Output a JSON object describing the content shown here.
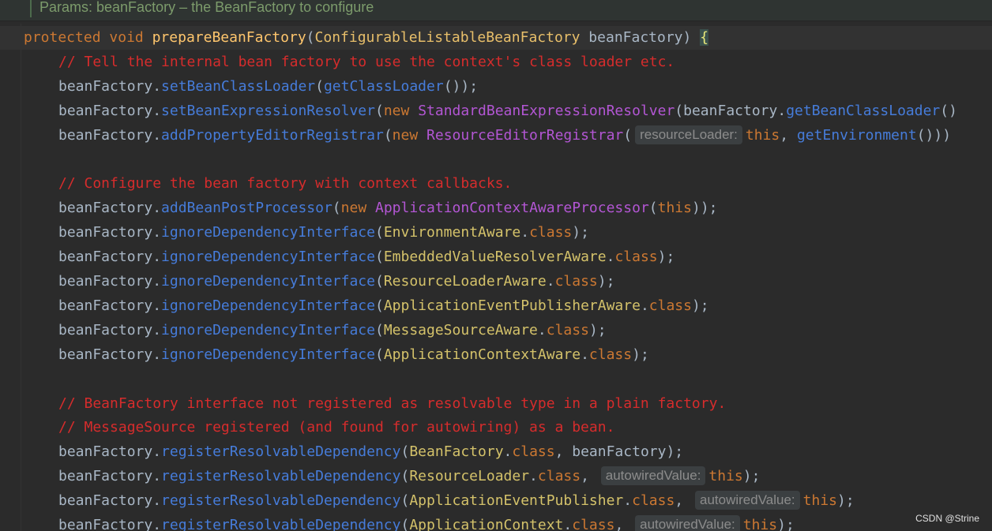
{
  "doc_comment": "Params: beanFactory – the BeanFactory to configure",
  "watermark": "CSDN @Strine",
  "colors": {
    "background": "#2b2b2b",
    "keyword": "#cc7832",
    "method_decl": "#ffc66d",
    "method_call": "#467cda",
    "constructor": "#b356d4",
    "class_ref": "#d4c26a",
    "comment": "#d62c2c",
    "hint": "#8c8c8c"
  },
  "lines": [
    [
      {
        "t": "protected",
        "c": "kw"
      },
      {
        "t": " "
      },
      {
        "t": "void",
        "c": "kw"
      },
      {
        "t": " "
      },
      {
        "t": "prepareBeanFactory",
        "c": "fn"
      },
      {
        "t": "("
      },
      {
        "t": "ConfigurableListableBeanFactory",
        "c": "ty"
      },
      {
        "t": " beanFactory) "
      },
      {
        "t": "{",
        "c": "brace"
      }
    ],
    [
      {
        "t": "// Tell the internal bean factory to use the context's class loader etc.",
        "c": "cm"
      }
    ],
    [
      {
        "t": "beanFactory."
      },
      {
        "t": "setBeanClassLoader",
        "c": "mt"
      },
      {
        "t": "("
      },
      {
        "t": "getClassLoader",
        "c": "mt"
      },
      {
        "t": "());"
      }
    ],
    [
      {
        "t": "beanFactory."
      },
      {
        "t": "setBeanExpressionResolver",
        "c": "mt"
      },
      {
        "t": "("
      },
      {
        "t": "new",
        "c": "kw"
      },
      {
        "t": " "
      },
      {
        "t": "StandardBeanExpressionResolver",
        "c": "ctor"
      },
      {
        "t": "(beanFactory."
      },
      {
        "t": "getBeanClassLoader",
        "c": "mt"
      },
      {
        "t": "()"
      }
    ],
    [
      {
        "t": "beanFactory."
      },
      {
        "t": "addPropertyEditorRegistrar",
        "c": "mt"
      },
      {
        "t": "("
      },
      {
        "t": "new",
        "c": "kw"
      },
      {
        "t": " "
      },
      {
        "t": "ResourceEditorRegistrar",
        "c": "ctor"
      },
      {
        "t": "("
      },
      {
        "t": "resourceLoader:",
        "c": "hint"
      },
      {
        "t": "this",
        "c": "kw"
      },
      {
        "t": ", "
      },
      {
        "t": "getEnvironment",
        "c": "mt"
      },
      {
        "t": "()))"
      }
    ],
    [],
    [
      {
        "t": "// Configure the bean factory with context callbacks.",
        "c": "cm"
      }
    ],
    [
      {
        "t": "beanFactory."
      },
      {
        "t": "addBeanPostProcessor",
        "c": "mt"
      },
      {
        "t": "("
      },
      {
        "t": "new",
        "c": "kw"
      },
      {
        "t": " "
      },
      {
        "t": "ApplicationContextAwareProcessor",
        "c": "ctor"
      },
      {
        "t": "("
      },
      {
        "t": "this",
        "c": "kw"
      },
      {
        "t": "));"
      }
    ],
    [
      {
        "t": "beanFactory."
      },
      {
        "t": "ignoreDependencyInterface",
        "c": "mt"
      },
      {
        "t": "("
      },
      {
        "t": "EnvironmentAware",
        "c": "cls"
      },
      {
        "t": "."
      },
      {
        "t": "class",
        "c": "kw"
      },
      {
        "t": ");"
      }
    ],
    [
      {
        "t": "beanFactory."
      },
      {
        "t": "ignoreDependencyInterface",
        "c": "mt"
      },
      {
        "t": "("
      },
      {
        "t": "EmbeddedValueResolverAware",
        "c": "cls"
      },
      {
        "t": "."
      },
      {
        "t": "class",
        "c": "kw"
      },
      {
        "t": ");"
      }
    ],
    [
      {
        "t": "beanFactory."
      },
      {
        "t": "ignoreDependencyInterface",
        "c": "mt"
      },
      {
        "t": "("
      },
      {
        "t": "ResourceLoaderAware",
        "c": "cls"
      },
      {
        "t": "."
      },
      {
        "t": "class",
        "c": "kw"
      },
      {
        "t": ");"
      }
    ],
    [
      {
        "t": "beanFactory."
      },
      {
        "t": "ignoreDependencyInterface",
        "c": "mt"
      },
      {
        "t": "("
      },
      {
        "t": "ApplicationEventPublisherAware",
        "c": "cls"
      },
      {
        "t": "."
      },
      {
        "t": "class",
        "c": "kw"
      },
      {
        "t": ");"
      }
    ],
    [
      {
        "t": "beanFactory."
      },
      {
        "t": "ignoreDependencyInterface",
        "c": "mt"
      },
      {
        "t": "("
      },
      {
        "t": "MessageSourceAware",
        "c": "cls"
      },
      {
        "t": "."
      },
      {
        "t": "class",
        "c": "kw"
      },
      {
        "t": ");"
      }
    ],
    [
      {
        "t": "beanFactory."
      },
      {
        "t": "ignoreDependencyInterface",
        "c": "mt"
      },
      {
        "t": "("
      },
      {
        "t": "ApplicationContextAware",
        "c": "cls"
      },
      {
        "t": "."
      },
      {
        "t": "class",
        "c": "kw"
      },
      {
        "t": ");"
      }
    ],
    [],
    [
      {
        "t": "// BeanFactory interface not registered as resolvable type in a plain factory.",
        "c": "cm"
      }
    ],
    [
      {
        "t": "// MessageSource registered (and found for autowiring) as a bean.",
        "c": "cm"
      }
    ],
    [
      {
        "t": "beanFactory."
      },
      {
        "t": "registerResolvableDependency",
        "c": "mt"
      },
      {
        "t": "("
      },
      {
        "t": "BeanFactory",
        "c": "cls"
      },
      {
        "t": "."
      },
      {
        "t": "class",
        "c": "kw"
      },
      {
        "t": ", beanFactory);"
      }
    ],
    [
      {
        "t": "beanFactory."
      },
      {
        "t": "registerResolvableDependency",
        "c": "mt"
      },
      {
        "t": "("
      },
      {
        "t": "ResourceLoader",
        "c": "cls"
      },
      {
        "t": "."
      },
      {
        "t": "class",
        "c": "kw"
      },
      {
        "t": ", "
      },
      {
        "t": "autowiredValue:",
        "c": "hint"
      },
      {
        "t": "this",
        "c": "kw"
      },
      {
        "t": ");"
      }
    ],
    [
      {
        "t": "beanFactory."
      },
      {
        "t": "registerResolvableDependency",
        "c": "mt"
      },
      {
        "t": "("
      },
      {
        "t": "ApplicationEventPublisher",
        "c": "cls"
      },
      {
        "t": "."
      },
      {
        "t": "class",
        "c": "kw"
      },
      {
        "t": ", "
      },
      {
        "t": "autowiredValue:",
        "c": "hint"
      },
      {
        "t": "this",
        "c": "kw"
      },
      {
        "t": ");"
      }
    ],
    [
      {
        "t": "beanFactory."
      },
      {
        "t": "registerResolvableDependency",
        "c": "mt"
      },
      {
        "t": "("
      },
      {
        "t": "ApplicationContext",
        "c": "cls"
      },
      {
        "t": "."
      },
      {
        "t": "class",
        "c": "kw"
      },
      {
        "t": ", "
      },
      {
        "t": "autowiredValue:",
        "c": "hint"
      },
      {
        "t": "this",
        "c": "kw"
      },
      {
        "t": ");"
      }
    ]
  ]
}
